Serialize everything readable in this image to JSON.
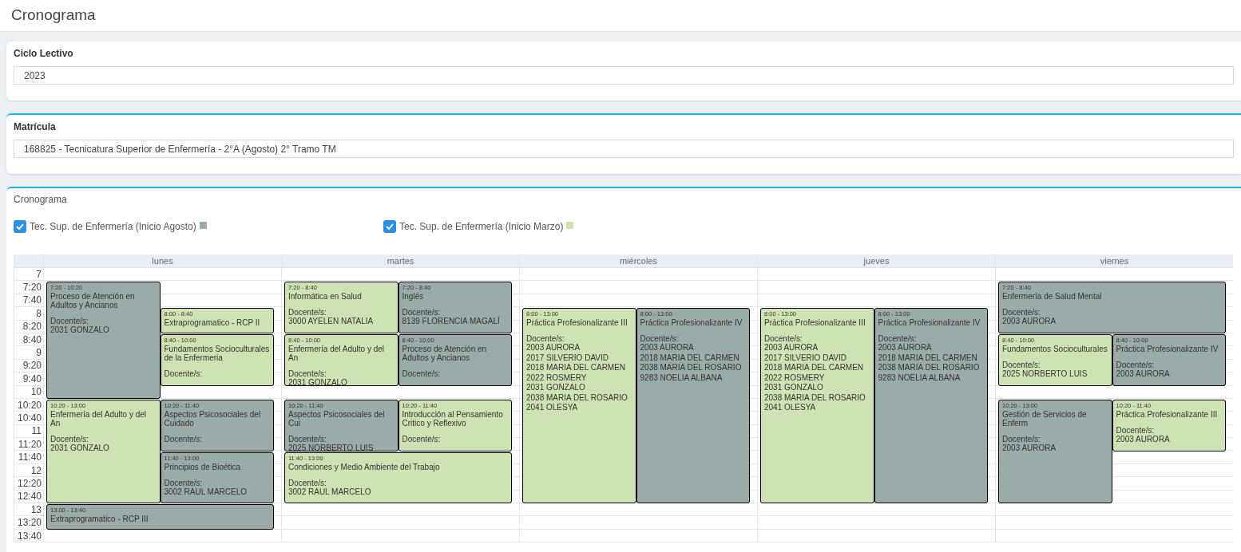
{
  "page": {
    "title": "Cronograma"
  },
  "ciclo_lectivo": {
    "label": "Ciclo Lectivo",
    "value": "2023"
  },
  "matricula": {
    "label": "Matrícula",
    "value": "168825 - Tecnicatura Superior de Enfermería - 2°A (Agosto) 2° Tramo TM"
  },
  "cronograma": {
    "title": "Cronograma",
    "legend": [
      {
        "label": "Tec. Sup. de Enfermería (Inicio Agosto)",
        "checked": true,
        "color": "#9aabaa"
      },
      {
        "label": "Tec. Sup. de Enfermería (Inicio Marzo)",
        "checked": true,
        "color": "#cfe2b4"
      }
    ],
    "times": [
      "7",
      "7:20",
      "7:40",
      "8",
      "8:20",
      "8:40",
      "9",
      "9:20",
      "9:40",
      "10",
      "10:20",
      "10:40",
      "11",
      "11:20",
      "11:40",
      "12",
      "12:20",
      "12:40",
      "13",
      "13:20",
      "13:40"
    ],
    "days": [
      {
        "name": "lunes",
        "events": [
          {
            "time": "7:20 - 10:20",
            "title": "Proceso de Atención en Adultos y Ancianos",
            "docente_label": "Docente/s:",
            "teachers": [
              "2031 GONZALO"
            ],
            "color": "#9aabaa"
          },
          {
            "time": "8:00 - 8:40",
            "title": "Extraprogramatico - RCP II",
            "color": "#cfe2b4"
          },
          {
            "time": "8:40 - 10:00",
            "title": "Fundamentos Socioculturales de la Enfermeria",
            "docente_label": "Docente/s:",
            "color": "#cfe2b4"
          },
          {
            "time": "10:20 - 13:00",
            "title": "Enfermería del Adulto y del An",
            "docente_label": "Docente/s:",
            "teachers": [
              "2031 GONZALO"
            ],
            "color": "#cfe2b4"
          },
          {
            "time": "10:20 - 11:40",
            "title": "Aspectos Psicosociales del Cuidado",
            "docente_label": "Docente/s:",
            "color": "#9aabaa"
          },
          {
            "time": "11:40 - 13:00",
            "title": "Principios de Bioética",
            "docente_label": "Docente/s:",
            "teachers": [
              "3002 RAUL MARCELO"
            ],
            "color": "#9aabaa"
          },
          {
            "time": "13:00 - 13:40",
            "title": "Extraprogramatico - RCP III",
            "color": "#9aabaa"
          }
        ]
      },
      {
        "name": "martes",
        "events": [
          {
            "time": "7:20 - 8:40",
            "title": "Informática en Salud",
            "docente_label": "Docente/s:",
            "teachers": [
              "3000 AYELEN NATALIA"
            ],
            "color": "#cfe2b4"
          },
          {
            "time": "7:20 - 8:40",
            "title": "Inglés",
            "docente_label": "Docente/s:",
            "teachers": [
              "8139 FLORENCIA MAGALÍ"
            ],
            "color": "#9aabaa"
          },
          {
            "time": "8:40 - 10:00",
            "title": "Enfermería del Adulto y del An",
            "docente_label": "Docente/s:",
            "teachers": [
              "2031 GONZALO"
            ],
            "color": "#cfe2b4"
          },
          {
            "time": "8:40 - 10:00",
            "title": "Proceso de Atención en Adultos y Ancianos",
            "docente_label": "Docente/s:",
            "color": "#9aabaa"
          },
          {
            "time": "10:20 - 11:40",
            "title": "Aspectos Psicosociales del Cui",
            "docente_label": "Docente/s:",
            "teachers": [
              "2025 NORBERTO LUIS"
            ],
            "color": "#9aabaa"
          },
          {
            "time": "10:20 - 11:40",
            "title": "Introducción al Pensamiento Critico y Reflexivo",
            "docente_label": "Docente/s:",
            "color": "#cfe2b4"
          },
          {
            "time": "11:40 - 13:00",
            "title": "Condiciones y Medio Ambiente del Trabajo",
            "docente_label": "Docente/s:",
            "teachers": [
              "3002 RAUL MARCELO"
            ],
            "color": "#cfe2b4"
          }
        ]
      },
      {
        "name": "miércoles",
        "events": [
          {
            "time": "8:00 - 13:00",
            "title": "Práctica Profesionalizante III",
            "docente_label": "Docente/s:",
            "teachers": [
              "2003 AURORA",
              "2017 SILVERIO DAVID",
              "2018 MARIA DEL CARMEN",
              "2022 ROSMERY",
              "2031 GONZALO",
              "2038 MARIA DEL ROSARIO",
              "2041 OLESYA"
            ],
            "color": "#cfe2b4"
          },
          {
            "time": "8:00 - 13:00",
            "title": "Práctica Profesionalizante IV",
            "docente_label": "Docente/s:",
            "teachers": [
              "2003 AURORA",
              "2018 MARIA DEL CARMEN",
              "2038 MARIA DEL ROSARIO",
              "9283 NOELIA ALBANA"
            ],
            "color": "#9aabaa"
          }
        ]
      },
      {
        "name": "jueves",
        "events": [
          {
            "time": "8:00 - 13:00",
            "title": "Práctica Profesionalizante III",
            "docente_label": "Docente/s:",
            "teachers": [
              "2003 AURORA",
              "2017 SILVERIO DAVID",
              "2018 MARIA DEL CARMEN",
              "2022 ROSMERY",
              "2031 GONZALO",
              "2038 MARIA DEL ROSARIO",
              "2041 OLESYA"
            ],
            "color": "#cfe2b4"
          },
          {
            "time": "8:00 - 13:00",
            "title": "Práctica Profesionalizante IV",
            "docente_label": "Docente/s:",
            "teachers": [
              "2003 AURORA",
              "2018 MARIA DEL CARMEN",
              "2038 MARIA DEL ROSARIO",
              "9283 NOELIA ALBANA"
            ],
            "color": "#9aabaa"
          }
        ]
      },
      {
        "name": "viernes",
        "events": [
          {
            "time": "7:20 - 8:40",
            "title": "Enfermería de Salud Mental",
            "docente_label": "Docente/s:",
            "teachers": [
              "2003 AURORA"
            ],
            "color": "#9aabaa"
          },
          {
            "time": "8:40 - 10:00",
            "title": "Fundamentos Socioculturales",
            "docente_label": "Docente/s:",
            "teachers": [
              "2025 NORBERTO LUIS"
            ],
            "color": "#cfe2b4"
          },
          {
            "time": "8:40 - 10:00",
            "title": "Práctica Profesionalizante IV",
            "docente_label": "Docente/s:",
            "teachers": [
              "2003 AURORA"
            ],
            "color": "#9aabaa"
          },
          {
            "time": "10:20 - 13:00",
            "title": "Gestión de Servicios de Enferm",
            "docente_label": "Docente/s:",
            "teachers": [
              "2003 AURORA"
            ],
            "color": "#9aabaa"
          },
          {
            "time": "10:20 - 11:40",
            "title": "Práctica Profesionalizante III",
            "docente_label": "Docente/s:",
            "teachers": [
              "2003 AURORA"
            ],
            "color": "#cfe2b4"
          }
        ]
      }
    ]
  }
}
